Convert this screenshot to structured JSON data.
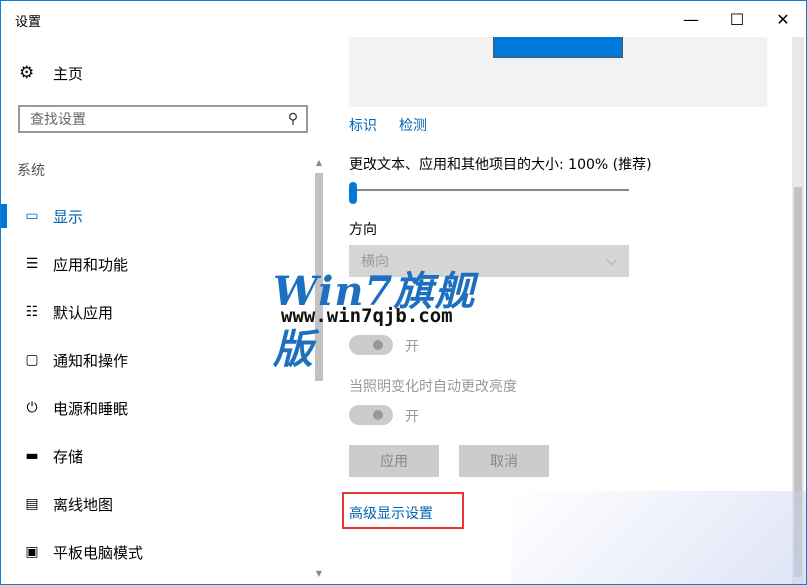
{
  "window": {
    "title": "设置",
    "minimize_glyph": "—",
    "maximize_glyph": "☐",
    "close_glyph": "✕"
  },
  "sidebar": {
    "home_label": "主页",
    "home_icon": "gear-icon",
    "search_placeholder": "查找设置",
    "section_label": "系统",
    "items": [
      {
        "label": "显示",
        "icon": "monitor-icon",
        "glyph": "▭",
        "selected": true
      },
      {
        "label": "应用和功能",
        "icon": "apps-list-icon",
        "glyph": "☰"
      },
      {
        "label": "默认应用",
        "icon": "default-apps-icon",
        "glyph": "☷"
      },
      {
        "label": "通知和操作",
        "icon": "notification-icon",
        "glyph": "▢"
      },
      {
        "label": "电源和睡眠",
        "icon": "power-icon",
        "glyph": "⏻"
      },
      {
        "label": "存储",
        "icon": "storage-icon",
        "glyph": "▬"
      },
      {
        "label": "离线地图",
        "icon": "map-icon",
        "glyph": "▤"
      },
      {
        "label": "平板电脑模式",
        "icon": "tablet-icon",
        "glyph": "▣"
      }
    ]
  },
  "display": {
    "identify_link": "标识",
    "detect_link": "检测",
    "scale_label": "更改文本、应用和其他项目的大小: 100% (推荐)",
    "scale_value_percent": 100,
    "orientation_label": "方向",
    "orientation_value": "横向",
    "toggle1_state": "开",
    "brightness_auto_label": "当照明变化时自动更改亮度",
    "toggle2_state": "开",
    "apply_button": "应用",
    "cancel_button": "取消",
    "advanced_link": "高级显示设置",
    "accent_color": "#0078d7",
    "highlight_color": "#e53935"
  },
  "watermark": {
    "brand": "Win7旗舰版",
    "url": "www.win7qjb.com"
  }
}
